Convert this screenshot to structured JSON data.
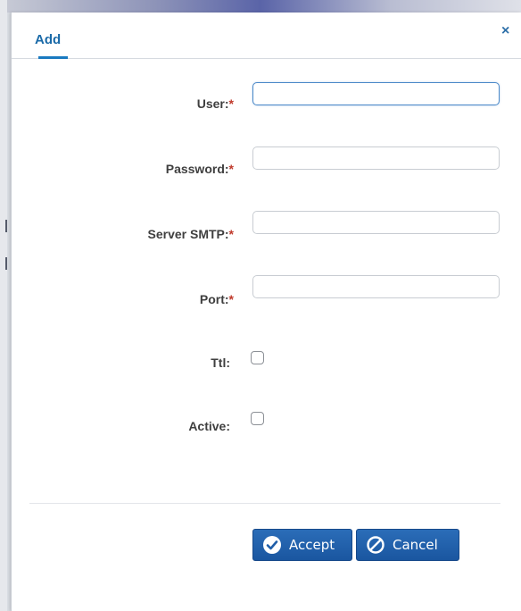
{
  "dialog": {
    "title": "Add",
    "close_label": "×"
  },
  "form": {
    "user": {
      "label": "User:",
      "required_mark": "*",
      "value": ""
    },
    "password": {
      "label": "Password:",
      "required_mark": "*",
      "value": ""
    },
    "server_smtp": {
      "label": "Server SMTP:",
      "required_mark": "*",
      "value": ""
    },
    "port": {
      "label": "Port:",
      "required_mark": "*",
      "value": ""
    },
    "ttl": {
      "label": "Ttl:",
      "checked": false
    },
    "active": {
      "label": "Active:",
      "checked": false
    }
  },
  "buttons": {
    "accept_label": "Accept",
    "cancel_label": "Cancel"
  },
  "colors": {
    "accent": "#1a6aa8",
    "required": "#c0392b",
    "button": "#1f5ea8"
  },
  "icons": {
    "accept": "check-circle-icon",
    "cancel": "ban-icon",
    "close": "close-icon"
  }
}
